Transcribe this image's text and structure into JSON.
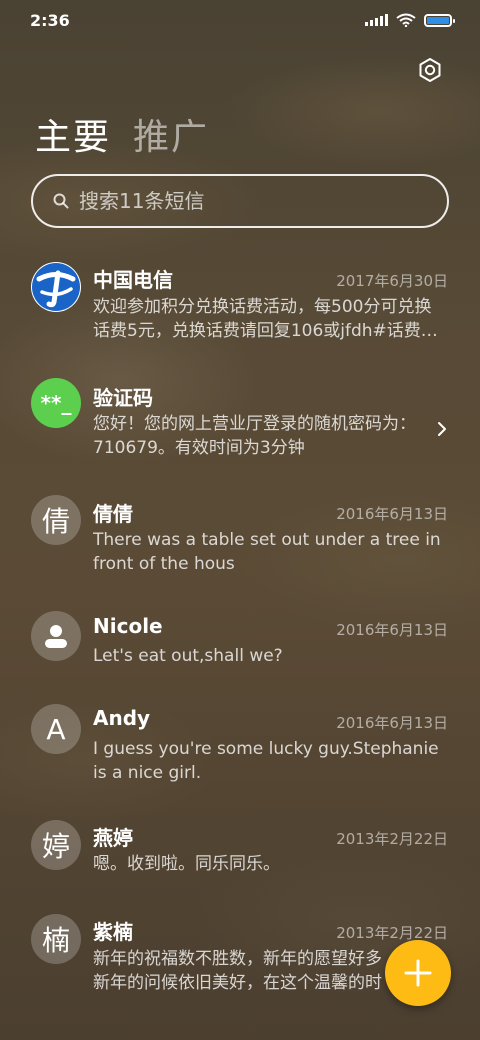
{
  "status_bar": {
    "time": "2:36"
  },
  "tabs": [
    {
      "label": "主要"
    },
    {
      "label": "推广"
    }
  ],
  "search": {
    "placeholder": "搜索11条短信"
  },
  "threads": [
    {
      "name": "中国电信",
      "date": "2017年6月30日",
      "line1": "欢迎参加积分兑换话费活动，每500分可兑换",
      "line2": "话费5元，兑换话费请回复106或jfdh#话费…",
      "avatar_icon": "china-telecom-logo-icon"
    },
    {
      "name": "验证码",
      "date": "",
      "line1": "您好！您的网上营业厅登录的随机密码为：",
      "line2": "710679。有效时间为3分钟",
      "avatar_text": "**_"
    },
    {
      "name": "倩倩",
      "date": "2016年6月13日",
      "line1": "There was a table set out under a tree in",
      "line2": "front of the hous",
      "avatar_text": "倩"
    },
    {
      "name": "Nicole",
      "date": "2016年6月13日",
      "line1": "Let's eat out,shall we?",
      "line2": "",
      "avatar_icon": "person-icon"
    },
    {
      "name": "Andy",
      "date": "2016年6月13日",
      "line1": "I guess you're some lucky guy.Stephanie",
      "line2": "is a nice girl.",
      "avatar_text": "A"
    },
    {
      "name": "燕婷",
      "date": "2013年2月22日",
      "line1": "嗯。收到啦。同乐同乐。",
      "line2": "",
      "avatar_text": "婷"
    },
    {
      "name": "紫楠",
      "date": "2013年2月22日",
      "line1": "新年的祝福数不胜数，新年的愿望好多",
      "line2": "新年的问候依旧美好，在这个温馨的时",
      "avatar_text": "楠"
    }
  ],
  "colors": {
    "fab": "#fdbb14",
    "telecom_blue": "#1a64c8",
    "verify_green": "#5ccf4e"
  },
  "icons": {
    "settings": "gear-icon",
    "search": "search-icon",
    "compose": "plus-icon",
    "chevron": "chevron-right-icon"
  }
}
